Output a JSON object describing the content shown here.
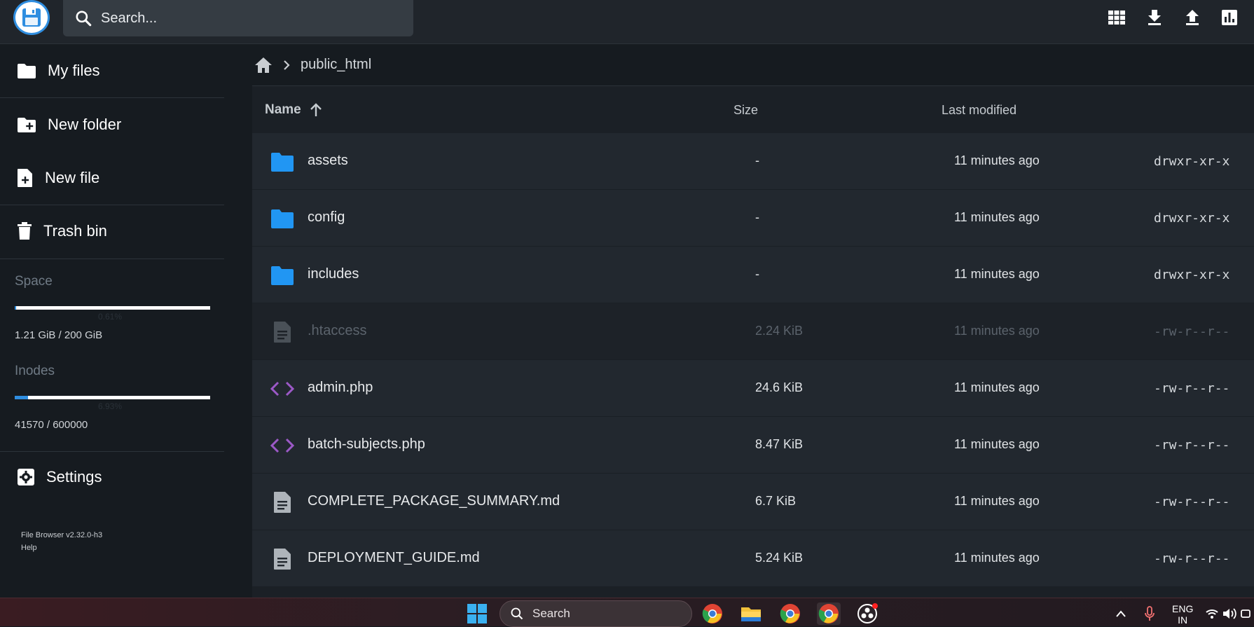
{
  "header": {
    "search_placeholder": "Search...",
    "actions": [
      "grid-view",
      "download",
      "upload",
      "info"
    ]
  },
  "sidebar": {
    "items": [
      {
        "label": "My files",
        "icon": "folder-icon"
      },
      {
        "label": "New folder",
        "icon": "new-folder-icon"
      },
      {
        "label": "New file",
        "icon": "new-file-icon"
      },
      {
        "label": "Trash bin",
        "icon": "trash-icon"
      }
    ],
    "space": {
      "title": "Space",
      "text": "1.21 GiB / 200 GiB",
      "pct_label": "0.61%",
      "fraction": 0.0061
    },
    "inodes": {
      "title": "Inodes",
      "text": "41570 / 600000",
      "pct_label": "6.93%",
      "fraction": 0.0693
    },
    "settings_label": "Settings",
    "footer": {
      "version": "File Browser v2.32.0-h3",
      "help": "Help"
    }
  },
  "breadcrumb": {
    "path": "public_html"
  },
  "list": {
    "headers": {
      "name": "Name",
      "size": "Size",
      "modified": "Last modified"
    },
    "rows": [
      {
        "name": "assets",
        "size": "-",
        "modified": "11 minutes ago",
        "perm": "drwxr-xr-x",
        "type": "folder"
      },
      {
        "name": "config",
        "size": "-",
        "modified": "11 minutes ago",
        "perm": "drwxr-xr-x",
        "type": "folder"
      },
      {
        "name": "includes",
        "size": "-",
        "modified": "11 minutes ago",
        "perm": "drwxr-xr-x",
        "type": "folder"
      },
      {
        "name": ".htaccess",
        "size": "2.24 KiB",
        "modified": "11 minutes ago",
        "perm": "-rw-r--r--",
        "type": "doc",
        "dim": true
      },
      {
        "name": "admin.php",
        "size": "24.6 KiB",
        "modified": "11 minutes ago",
        "perm": "-rw-r--r--",
        "type": "code"
      },
      {
        "name": "batch-subjects.php",
        "size": "8.47 KiB",
        "modified": "11 minutes ago",
        "perm": "-rw-r--r--",
        "type": "code"
      },
      {
        "name": "COMPLETE_PACKAGE_SUMMARY.md",
        "size": "6.7 KiB",
        "modified": "11 minutes ago",
        "perm": "-rw-r--r--",
        "type": "doc"
      },
      {
        "name": "DEPLOYMENT_GUIDE.md",
        "size": "5.24 KiB",
        "modified": "11 minutes ago",
        "perm": "-rw-r--r--",
        "type": "doc"
      }
    ]
  },
  "taskbar": {
    "search_label": "Search",
    "lang": "ENG",
    "region": "IN"
  },
  "colors": {
    "accent": "#2f8ee0",
    "folder": "#2196f3",
    "code": "#9c59c7"
  }
}
